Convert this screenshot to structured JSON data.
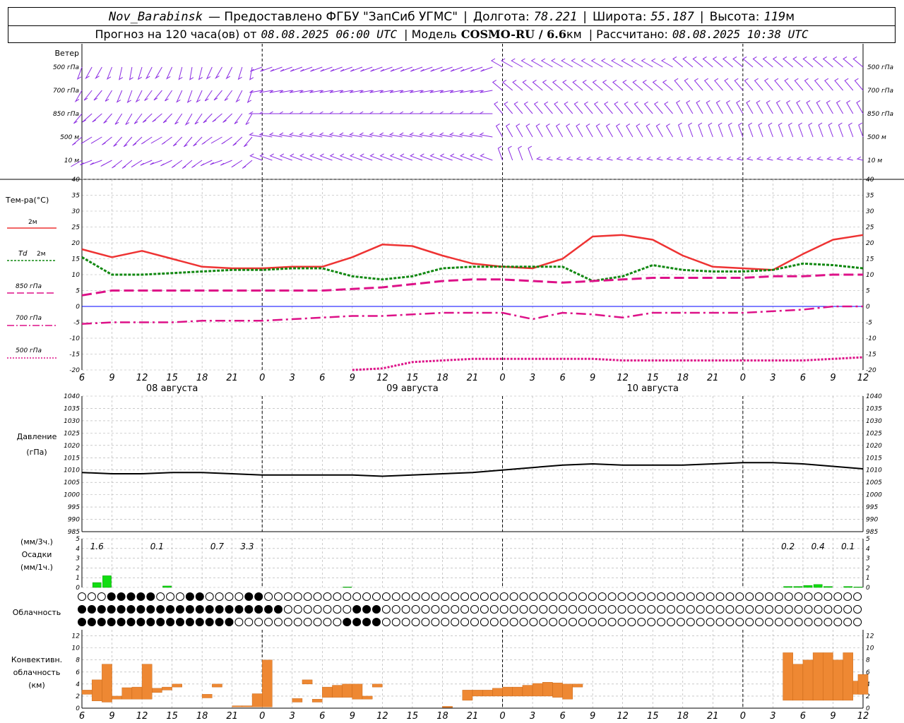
{
  "header": {
    "station": "Nov_Barabinsk",
    "provider": "— Предоставлено ФГБУ \"ЗапСиб УГМС\"",
    "lon_label": "Долгота:",
    "lon": "78.221",
    "lat_label": "Широта:",
    "lat": "55.187",
    "alt_label": "Высота:",
    "alt": "119",
    "alt_unit": "м",
    "forecast_label": "Прогноз на 120 часа(ов) от",
    "forecast_from": "08.08.2025 06:00 UTC",
    "model_label": "| Модель",
    "model": "COSMO-RU / 6.6",
    "model_unit": "км",
    "calc_label": "| Рассчитано:",
    "calc": "08.08.2025 10:38 UTC"
  },
  "time_axis": {
    "hour_ticks": [
      "6",
      "9",
      "12",
      "15",
      "18",
      "21",
      "0",
      "3",
      "6",
      "9",
      "12",
      "15",
      "18",
      "21",
      "0",
      "3",
      "6",
      "9",
      "12",
      "15",
      "18",
      "21",
      "0",
      "3",
      "6",
      "9",
      "12"
    ],
    "date_labels": [
      "08 августа",
      "09 августа",
      "10 августа"
    ]
  },
  "colors": {
    "wind": "#8a2be2",
    "t2m": "#ee3333",
    "td2m": "#118811",
    "t850": "#dd1188",
    "t700": "#dd1188",
    "t500": "#dd1188",
    "pressure": "#000000",
    "precip": "#11dd11",
    "conv": "#ee8833",
    "zero_line": "#0000ff"
  },
  "wind_panel": {
    "title": "Ветер",
    "levels": [
      "500 гПа",
      "700 гПа",
      "850 гПа",
      "500 м",
      "10 м"
    ]
  },
  "chart_data": [
    {
      "type": "line",
      "title": "Тем-ра(°C)",
      "ylabel": "Тем-ра(°C)",
      "ylim": [
        -20,
        40
      ],
      "y_ticks": [
        "40",
        "35",
        "30",
        "25",
        "20",
        "15",
        "10",
        "5",
        "0",
        "-5",
        "-10",
        "-15",
        "-20"
      ],
      "x_hours": [
        0,
        3,
        6,
        9,
        12,
        15,
        18,
        21,
        24,
        27,
        30,
        33,
        36,
        39,
        42,
        45,
        48,
        51,
        54,
        57,
        60,
        63,
        66,
        69,
        72,
        75,
        78
      ],
      "series": [
        {
          "name": "2м",
          "values": [
            18,
            15.5,
            17.5,
            15,
            12.5,
            12,
            12,
            12.5,
            12.5,
            15.5,
            19.5,
            19,
            16,
            13.5,
            12.5,
            12,
            15,
            22,
            22.5,
            21,
            16,
            12.5,
            12,
            11.5,
            16.5,
            21,
            22.5
          ]
        },
        {
          "name": "Td 2м",
          "values": [
            15.5,
            10,
            10,
            10.5,
            11,
            11.5,
            11.5,
            12,
            12,
            9.5,
            8.5,
            9.5,
            12,
            12.5,
            12.5,
            12.5,
            12.5,
            8,
            9.5,
            13,
            11.5,
            11,
            11,
            11.5,
            13.5,
            13,
            12
          ]
        },
        {
          "name": "850 гПа",
          "values": [
            3.5,
            5,
            5,
            5,
            5,
            5,
            5,
            5,
            5,
            5.5,
            6,
            7,
            8,
            8.5,
            8.5,
            8,
            7.5,
            8,
            8.5,
            9,
            9,
            9,
            9,
            9.5,
            9.5,
            10,
            10
          ]
        },
        {
          "name": "700 гПа",
          "values": [
            -5.5,
            -5,
            -5,
            -5,
            -4.5,
            -4.5,
            -4.5,
            -4,
            -3.5,
            -3,
            -3,
            -2.5,
            -2,
            -2,
            -2,
            -4,
            -2,
            -2.5,
            -3.5,
            -2,
            -2,
            -2,
            -2,
            -1.5,
            -1,
            0,
            0
          ]
        },
        {
          "name": "500 гПа",
          "values": [
            null,
            null,
            null,
            null,
            null,
            null,
            null,
            null,
            null,
            -20,
            -19.5,
            -17.5,
            -17,
            -16.5,
            -16.5,
            -16.5,
            -16.5,
            -16.5,
            -17,
            -17,
            -17,
            -17,
            -17,
            -17,
            -17,
            -16.5,
            -16
          ]
        }
      ]
    },
    {
      "type": "line",
      "title": "Давление",
      "ylabel": "(гПа)",
      "ylim": [
        985,
        1040
      ],
      "y_ticks": [
        "1040",
        "1035",
        "1030",
        "1025",
        "1020",
        "1015",
        "1010",
        "1005",
        "1000",
        "995",
        "990",
        "985"
      ],
      "x_hours": [
        0,
        3,
        6,
        9,
        12,
        15,
        18,
        21,
        24,
        27,
        30,
        33,
        36,
        39,
        42,
        45,
        48,
        51,
        54,
        57,
        60,
        63,
        66,
        69,
        72,
        75,
        78
      ],
      "series": [
        {
          "name": "Давление",
          "values": [
            1009,
            1008.5,
            1008.5,
            1009,
            1009,
            1008.5,
            1008,
            1008,
            1008,
            1008,
            1007.5,
            1008,
            1008.5,
            1009,
            1010,
            1011,
            1012,
            1012.5,
            1012,
            1012,
            1012,
            1012.5,
            1013,
            1013,
            1012.5,
            1011.5,
            1010.5
          ]
        }
      ]
    },
    {
      "type": "bar",
      "title": "Осадки",
      "ylabel": "(мм/3ч.) Осадки (мм/1ч.)",
      "ylim": [
        0,
        5
      ],
      "y_ticks": [
        "5",
        "4",
        "3",
        "2",
        "1",
        "0"
      ],
      "hourly_hours": [
        1,
        2,
        3,
        4,
        5,
        6,
        7,
        8,
        9,
        10,
        11,
        12,
        13,
        14,
        15,
        16,
        17,
        18,
        19,
        20,
        21,
        22,
        23,
        24,
        25,
        26,
        27,
        28,
        29,
        30,
        31,
        32,
        33,
        34,
        35,
        36,
        37,
        38,
        39,
        40,
        41,
        42,
        43,
        44,
        45,
        46,
        47,
        48,
        49,
        50,
        51,
        52,
        53,
        54,
        55,
        56,
        57,
        58,
        59,
        60,
        61,
        62,
        63,
        64,
        65,
        66,
        67,
        68,
        69,
        70,
        71,
        72,
        73,
        74,
        75,
        76,
        77,
        78
      ],
      "hourly_values": [
        0,
        0.5,
        1.2,
        0,
        0,
        0,
        0,
        0,
        0.15,
        0,
        0,
        0,
        0,
        0,
        0,
        0,
        0,
        0,
        0,
        0,
        0,
        0,
        0,
        0,
        0,
        0,
        0.05,
        0,
        0,
        0,
        0,
        0,
        0,
        0,
        0,
        0,
        0,
        0,
        0,
        0,
        0,
        0,
        0,
        0,
        0,
        0,
        0,
        0,
        0,
        0,
        0,
        0,
        0,
        0,
        0,
        0,
        0,
        0,
        0,
        0,
        0,
        0,
        0,
        0,
        0,
        0,
        0,
        0,
        0,
        0,
        0.1,
        0.1,
        0.2,
        0.3,
        0.1,
        0,
        0.1,
        0.05,
        0
      ],
      "totals_3h": [
        {
          "hour": 3,
          "label": "1.6"
        },
        {
          "hour": 9,
          "label": "0.1"
        },
        {
          "hour": 15,
          "label": "0.7"
        },
        {
          "hour": 18,
          "label": "3.3"
        },
        {
          "hour": 72,
          "label": "0.2"
        },
        {
          "hour": 75,
          "label": "0.4"
        },
        {
          "hour": 78,
          "label": "0.1"
        }
      ]
    },
    {
      "type": "bar",
      "title": "Конвективн. облачность",
      "ylabel": "(км)",
      "ylim": [
        0,
        13
      ],
      "y_ticks": [
        "12",
        "10",
        "8",
        "6",
        "4",
        "2",
        "0"
      ],
      "layers": [
        {
          "hour": 0.5,
          "base": 2.3,
          "top": 3.0
        },
        {
          "hour": 1.5,
          "base": 1.2,
          "top": 4.7
        },
        {
          "hour": 2.5,
          "base": 1.0,
          "top": 7.3
        },
        {
          "hour": 3.5,
          "base": 1.5,
          "top": 2.0
        },
        {
          "hour": 4.5,
          "base": 1.5,
          "top": 3.4
        },
        {
          "hour": 5.5,
          "base": 1.5,
          "top": 3.5
        },
        {
          "hour": 6.5,
          "base": 1.5,
          "top": 7.3
        },
        {
          "hour": 7.5,
          "base": 2.6,
          "top": 3.3
        },
        {
          "hour": 8.5,
          "base": 3.0,
          "top": 3.5
        },
        {
          "hour": 9.5,
          "base": 3.5,
          "top": 4.0
        },
        {
          "hour": 12.5,
          "base": 1.7,
          "top": 2.3
        },
        {
          "hour": 13.5,
          "base": 3.5,
          "top": 4.0
        },
        {
          "hour": 15.5,
          "base": 0.2,
          "top": 0.4
        },
        {
          "hour": 16.5,
          "base": 0.2,
          "top": 0.4
        },
        {
          "hour": 17.5,
          "base": 0.2,
          "top": 2.4
        },
        {
          "hour": 18.5,
          "base": 0.2,
          "top": 8.0
        },
        {
          "hour": 21.5,
          "base": 1.0,
          "top": 1.6
        },
        {
          "hour": 22.5,
          "base": 4.0,
          "top": 4.7
        },
        {
          "hour": 23.5,
          "base": 1.0,
          "top": 1.5
        },
        {
          "hour": 24.5,
          "base": 1.8,
          "top": 3.5
        },
        {
          "hour": 25.5,
          "base": 1.8,
          "top": 3.8
        },
        {
          "hour": 26.5,
          "base": 1.8,
          "top": 4.0
        },
        {
          "hour": 27.5,
          "base": 1.5,
          "top": 4.0
        },
        {
          "hour": 28.5,
          "base": 1.5,
          "top": 2.0
        },
        {
          "hour": 29.5,
          "base": 3.5,
          "top": 4.0
        },
        {
          "hour": 36.5,
          "base": 0.1,
          "top": 0.3
        },
        {
          "hour": 38.5,
          "base": 1.3,
          "top": 3.0
        },
        {
          "hour": 39.5,
          "base": 2.0,
          "top": 3.0
        },
        {
          "hour": 40.5,
          "base": 2.0,
          "top": 3.0
        },
        {
          "hour": 41.5,
          "base": 2.0,
          "top": 3.3
        },
        {
          "hour": 42.5,
          "base": 2.0,
          "top": 3.5
        },
        {
          "hour": 43.5,
          "base": 2.0,
          "top": 3.5
        },
        {
          "hour": 44.5,
          "base": 2.0,
          "top": 3.8
        },
        {
          "hour": 45.5,
          "base": 2.0,
          "top": 4.1
        },
        {
          "hour": 46.5,
          "base": 2.0,
          "top": 4.3
        },
        {
          "hour": 47.5,
          "base": 1.8,
          "top": 4.2
        },
        {
          "hour": 48.5,
          "base": 1.5,
          "top": 4.0
        },
        {
          "hour": 49.5,
          "base": 3.5,
          "top": 4.0
        },
        {
          "hour": 70.5,
          "base": 1.3,
          "top": 9.2
        },
        {
          "hour": 71.5,
          "base": 1.3,
          "top": 7.3
        },
        {
          "hour": 72.5,
          "base": 1.3,
          "top": 8.0
        },
        {
          "hour": 73.5,
          "base": 1.3,
          "top": 9.2
        },
        {
          "hour": 74.5,
          "base": 1.3,
          "top": 9.2
        },
        {
          "hour": 75.5,
          "base": 1.3,
          "top": 8.0
        },
        {
          "hour": 76.5,
          "base": 1.3,
          "top": 9.2
        },
        {
          "hour": 77.5,
          "base": 2.3,
          "top": 4.5
        },
        {
          "hour": 78.0,
          "base": 2.3,
          "top": 5.6
        }
      ]
    }
  ],
  "legend": {
    "t_title": "Тем-ра(°C)",
    "t2m": "2м",
    "td_prefix": "Td",
    "td_level": "2м",
    "t850": "850 гПа",
    "t700": "700 гПа",
    "t500": "500 гПа",
    "pres_title": "Давление",
    "pres_unit": "(гПа)",
    "precip_unit3": "(мм/3ч.)",
    "precip_title": "Осадки",
    "precip_unit1": "(мм/1ч.)",
    "clouds_title": "Облачность",
    "conv_title1": "Конвективн.",
    "conv_title2": "облачность",
    "conv_unit": "(км)"
  },
  "clouds": {
    "rows": [
      "0000000011110012311100000000000111100000000000111111000000000000000000000000000000000000000000000000000000000000000000000000000000000000000000000000000000000000000000000000000000000000000000000000000000000000000000000000000000",
      "11111111111111111111111111111111111111111111111111111111111000000000000000000011111111100000000000000000000000000000000000000000000000000000000000000000000000000000000000000000000000000000000000000000000000000000000000000000000",
      "111111111111111111111111111111111111111111111000000000000000000000000000000111111111111000000000000000000000000000000000000000000000000000000000000000000000000000000000000000000000000000000000000000000000000000000000000000000000"
    ]
  }
}
